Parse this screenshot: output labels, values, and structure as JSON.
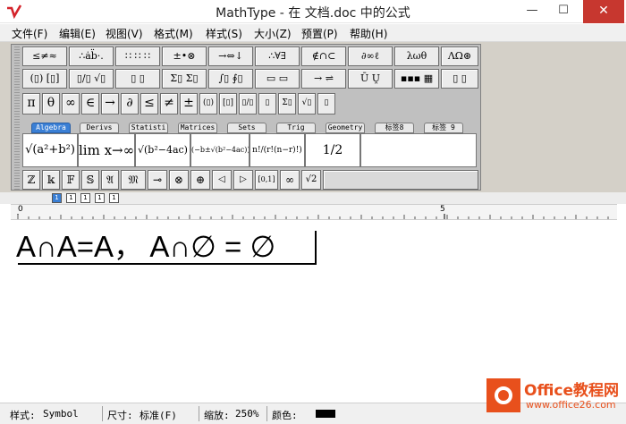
{
  "window": {
    "title": "MathType - 在 文档.doc 中的公式",
    "minimize": "—",
    "maximize": "☐",
    "close": "✕"
  },
  "menu": [
    "文件(F)",
    "编辑(E)",
    "视图(V)",
    "格式(M)",
    "样式(S)",
    "大小(Z)",
    "预置(P)",
    "帮助(H)"
  ],
  "palette_row1": [
    "≤≠≈",
    "∴ȧb̈·.",
    "∷ ∷ ∷",
    "±•⊗",
    "→⇔↓",
    "∴∀∃",
    "∉∩⊂",
    "∂∞ℓ",
    "λωθ",
    "ΛΩ⊛"
  ],
  "palette_row2": [
    "(▯) [▯]",
    "▯/▯ √▯",
    "▯ ▯",
    "Σ▯ Σ▯",
    "∫▯ ∮▯",
    "▭ ▭",
    "→ ⇌",
    "Ū Ṷ",
    "▪▪▪ ▦",
    "▯ ▯"
  ],
  "palette_row3": [
    "π",
    "θ",
    "∞",
    "∈",
    "→",
    "∂",
    "≤",
    "≠",
    "±",
    "(▯)",
    "[▯]",
    "▯/▯",
    "▯",
    "Σ▯",
    "√▯",
    "▯"
  ],
  "tabs": [
    "Algebra",
    "Derivs",
    "Statisti",
    "Matrices",
    "Sets",
    "Trig",
    "Geometry",
    "标签8",
    "标签 9"
  ],
  "templates": [
    "√(a²+b²)",
    "lim x→∞",
    "√(b²−4ac)",
    "(−b±√(b²−4ac))/2a",
    "n!/(r!(n−r)!)",
    "1/2"
  ],
  "palette_row5": [
    "ℤ",
    "𝕜",
    "𝔽",
    "𝕊",
    "𝔄",
    "𝔐",
    "⊸",
    "⊗",
    "⊕",
    "◁",
    "▷",
    "[0,1]",
    "∞",
    "√2"
  ],
  "small_buttons": [
    "1",
    "1",
    "1",
    "1",
    "1"
  ],
  "ruler": {
    "mark_start": "0",
    "mark_mid": "5"
  },
  "formula": "A∩A=A， A∩∅ = ∅",
  "status": {
    "style_label": "样式:",
    "style_value": "Symbol",
    "size_label": "尺寸:",
    "size_value": "标准(F)",
    "zoom_label": "缩放:",
    "zoom_value": "250%",
    "color_label": "颜色:",
    "color_value": "#000000"
  },
  "watermark": {
    "name": "Office教程网",
    "url": "www.office26.com"
  },
  "colors": {
    "accent_tab": "#3a7fd5",
    "close_button": "#c7372f",
    "watermark": "#e8501c"
  }
}
